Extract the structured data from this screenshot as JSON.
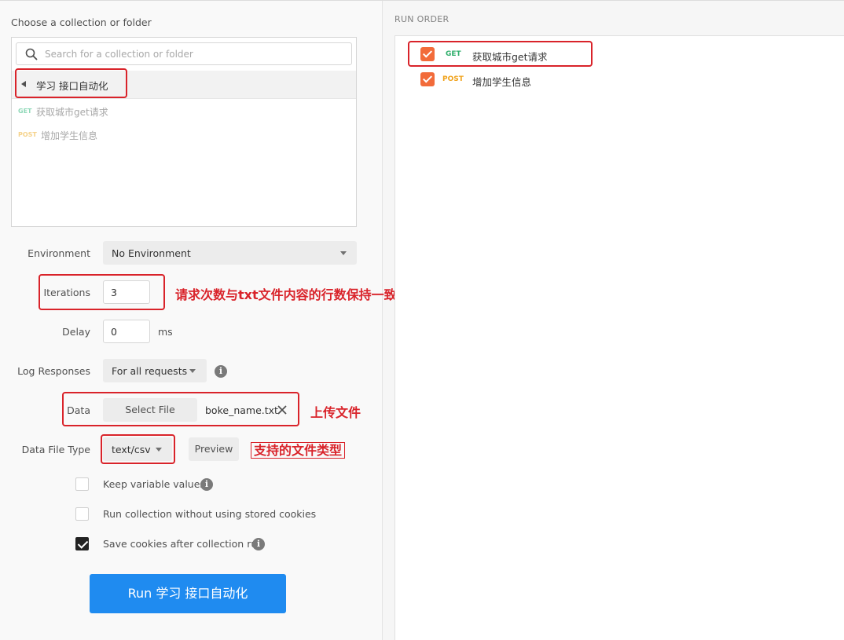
{
  "left": {
    "choose_label": "Choose a collection or folder",
    "search": {
      "placeholder": "Search for a collection or folder"
    },
    "folder_name": "学习 接口自动化",
    "requests": [
      {
        "method": "GET",
        "name": "获取城市get请求"
      },
      {
        "method": "POST",
        "name": "增加学生信息"
      }
    ]
  },
  "form": {
    "environment_label": "Environment",
    "environment_value": "No Environment",
    "iterations_label": "Iterations",
    "iterations_value": "3",
    "delay_label": "Delay",
    "delay_value": "0",
    "delay_unit": "ms",
    "log_label": "Log Responses",
    "log_value": "For all requests",
    "data_label": "Data",
    "select_file_label": "Select File",
    "file_name": "boke_name.txt",
    "data_file_type_label": "Data File Type",
    "data_file_type_value": "text/csv",
    "preview_label": "Preview",
    "options": [
      {
        "label": "Keep variable values",
        "checked": false
      },
      {
        "label": "Run collection without using stored cookies",
        "checked": false
      },
      {
        "label": "Save cookies after collection run",
        "checked": true
      }
    ],
    "run_button": "Run 学习 接口自动化"
  },
  "annotations": {
    "iterations_note": "请求次数与txt文件内容的行数保持一致",
    "upload_note": "上传文件",
    "file_types_note": "支持的文件类型"
  },
  "run_order": {
    "title": "RUN ORDER",
    "items": [
      {
        "method": "GET",
        "name": "获取城市get请求",
        "checked": true
      },
      {
        "method": "POST",
        "name": "增加学生信息",
        "checked": true
      }
    ]
  },
  "colors": {
    "accent_blue": "#1f8bf0",
    "annotation_red": "#d9232a",
    "checkbox_orange": "#f26b3a",
    "get_green": "#2fae6b",
    "post_orange": "#f0a21b"
  }
}
